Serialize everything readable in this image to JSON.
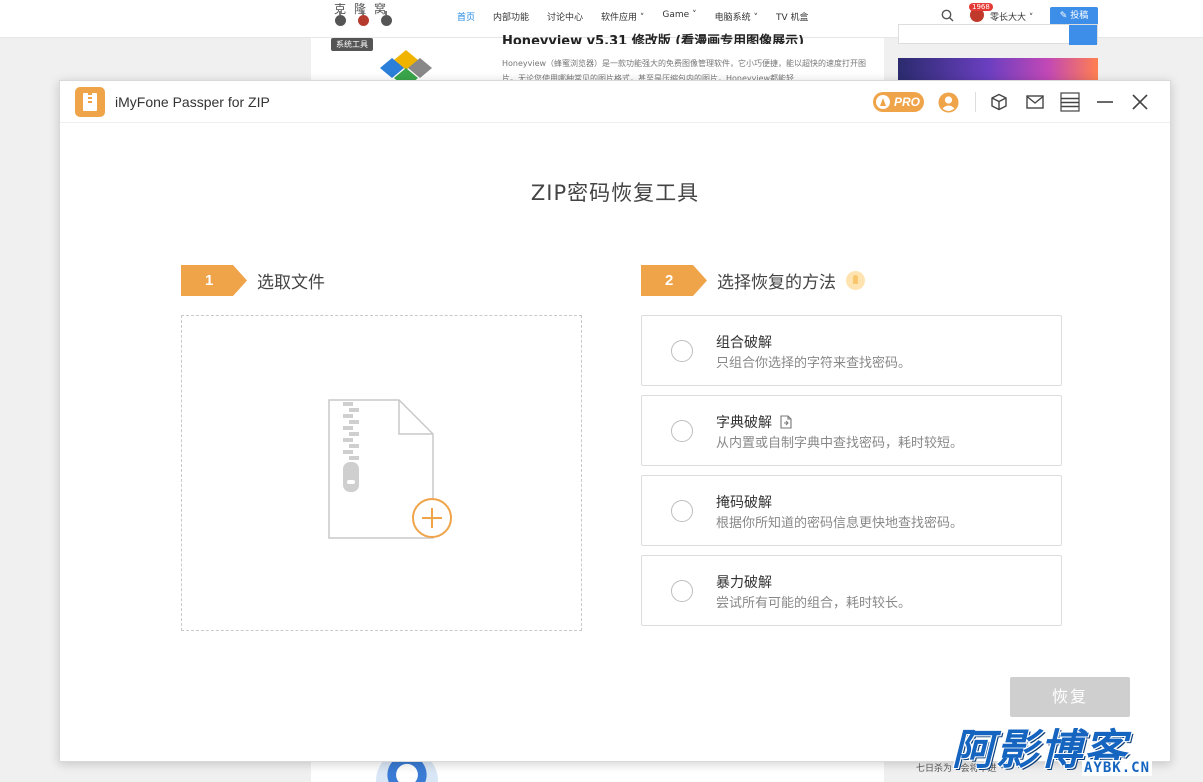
{
  "website": {
    "logo_text": "克隆窝",
    "nav": [
      {
        "label": "首页",
        "active": true
      },
      {
        "label": "内部功能",
        "active": false
      },
      {
        "label": "讨论中心",
        "active": false
      },
      {
        "label": "软件应用 ˅",
        "active": false
      },
      {
        "label": "Game ˅",
        "active": false
      },
      {
        "label": "电脑系统 ˅",
        "active": false
      },
      {
        "label": "TV 机盒",
        "active": false
      }
    ],
    "notification_count": "1968",
    "username": "零长大大 ˅",
    "post_button": "✎ 投稿",
    "category_tag": "系统工具",
    "article_title": "Honeyview v5.31 修改版 (看漫画专用图像展示)",
    "article_text": "Honeyview（蜂蜜浏览器）是一款功能强大的免费图像管理软件，它小巧便捷，能以超快的速度打开图片。无论您使用哪种常见的图片格式，甚至是压缩包内的图片，Honeyview都能轻...",
    "footer_text": "七日杀为 · 会将不进"
  },
  "app": {
    "title": "iMyFone Passper for ZIP",
    "pro_label": "PRO",
    "main_title": "ZIP密码恢复工具",
    "step1": {
      "number": "1",
      "label": "选取文件"
    },
    "step2": {
      "number": "2",
      "label": "选择恢复的方法"
    },
    "methods": [
      {
        "title": "组合破解",
        "desc": "只组合你选择的字符来查找密码。"
      },
      {
        "title": "字典破解",
        "desc": "从内置或自制字典中查找密码，耗时较短。"
      },
      {
        "title": "掩码破解",
        "desc": "根据你所知道的密码信息更快地查找密码。"
      },
      {
        "title": "暴力破解",
        "desc": "尝试所有可能的组合，耗时较长。"
      }
    ],
    "recover_button": "恢复",
    "accent_color": "#f0a44a",
    "disabled_button_color": "#cfcfcf"
  },
  "watermark": {
    "main": "阿影博客",
    "sub": "AYBK.CN"
  }
}
